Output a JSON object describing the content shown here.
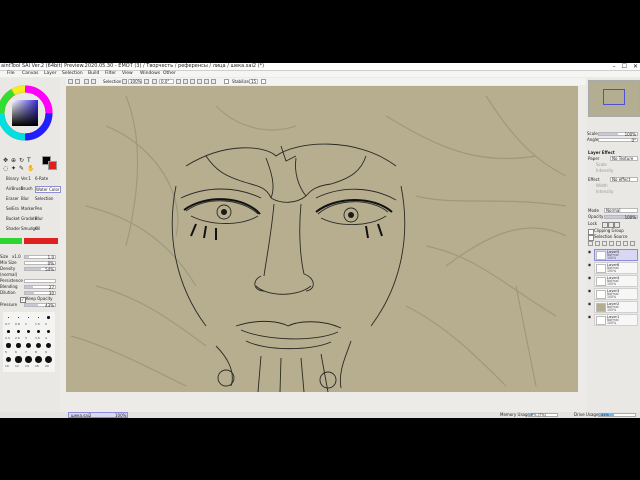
{
  "window": {
    "title": "aintTool SAI Ver.2 (64bit) Preview.2020.05.30 - EMOT (3) / Творчесть / референсы / лица / шека.sai2 (*)",
    "controls": [
      "–",
      "☐",
      "✕"
    ]
  },
  "menu": [
    "File",
    "Canvas",
    "Layer",
    "Selection",
    "Build",
    "Filter",
    "View",
    "Windows",
    "Other"
  ],
  "toolbar": {
    "selection_label": "Selection",
    "zoom": "100%",
    "angle": "0.0°",
    "stabilizer_label": "Stabilizer",
    "stabilizer_value": "15"
  },
  "tools": {
    "row1": [
      "Binary",
      "Ver.1",
      "6-Rate"
    ],
    "row2": [
      "AirBrush",
      "Brush",
      "Water Color"
    ],
    "row3": [
      "Eraser",
      "Blur",
      "Selection"
    ],
    "row4": [
      "SelEra",
      "Marker",
      "Pen"
    ],
    "row5": [
      "Bucket",
      "Gradate",
      "Blur"
    ],
    "row6": [
      "Shader",
      "Smudge",
      "Oil"
    ]
  },
  "brush": {
    "size_label": "Size",
    "size_mult": "x1.0",
    "size_value": "1.0",
    "min_size_label": "Min Size",
    "min_size_value": "0%",
    "density_label": "Density",
    "density_value": "54%",
    "normal_label": "(normal)",
    "persistence_label": "Persistence",
    "blending_label": "Blending",
    "blending_value": "27",
    "dilution_label": "Dilution",
    "dilution_value": "30",
    "keep_opacity_label": "Keep Opacity",
    "pressure_label": "Pressure",
    "pressure_value": "43%",
    "dot_sizes": [
      "0.7",
      "0.8",
      "1",
      "1.5",
      "2",
      "2.3",
      "2.6",
      "3",
      "3.5",
      "4",
      "5",
      "6",
      "7",
      "8",
      "9",
      "10",
      "12",
      "14",
      "16",
      "20"
    ]
  },
  "colors": {
    "primary": "#000000",
    "secondary": "#e0201a",
    "accent_green": "#2ed52e",
    "accent_red": "#e02020"
  },
  "navigator": {
    "zoom_label": "Scale",
    "zoom_value": "100%",
    "angle_label": "Angle",
    "angle_value": "0°"
  },
  "layer_effect": {
    "header": "Layer Effect",
    "texture_label": "Paper",
    "texture_value": "No Texture",
    "scale_label": "Scale",
    "intensity_label": "Intensity",
    "effect_label": "Effect",
    "effect_value": "No effect",
    "width_label": "Width",
    "intensity2_label": "Intensity"
  },
  "layer_props": {
    "mode_label": "Mode",
    "mode_value": "Normal",
    "opacity_label": "Opacity",
    "opacity_value": "100%",
    "lock_label": "Lock",
    "clipping_label": "Clipping Group",
    "selection_source_label": "Selection Source"
  },
  "layers": [
    {
      "name": "Layer5",
      "mode": "Normal",
      "opacity": "100%",
      "selected": true
    },
    {
      "name": "Layer6",
      "mode": "Normal",
      "opacity": "100%",
      "selected": false
    },
    {
      "name": "Layer4",
      "mode": "Normal",
      "opacity": "100%",
      "selected": false
    },
    {
      "name": "Layer3",
      "mode": "Normal",
      "opacity": "100%",
      "selected": false
    },
    {
      "name": "Layer2",
      "mode": "Normal",
      "opacity": "100%",
      "selected": false
    },
    {
      "name": "Layer1",
      "mode": "Normal",
      "opacity": "100%",
      "selected": false
    }
  ],
  "statusbar": {
    "doc_tab": "шека.sai2",
    "doc_zoom": "100%",
    "memory_label": "Memory Usage",
    "memory_value": "9% (7%)",
    "drive_label": "Drive Usage",
    "drive_value": "41%"
  }
}
